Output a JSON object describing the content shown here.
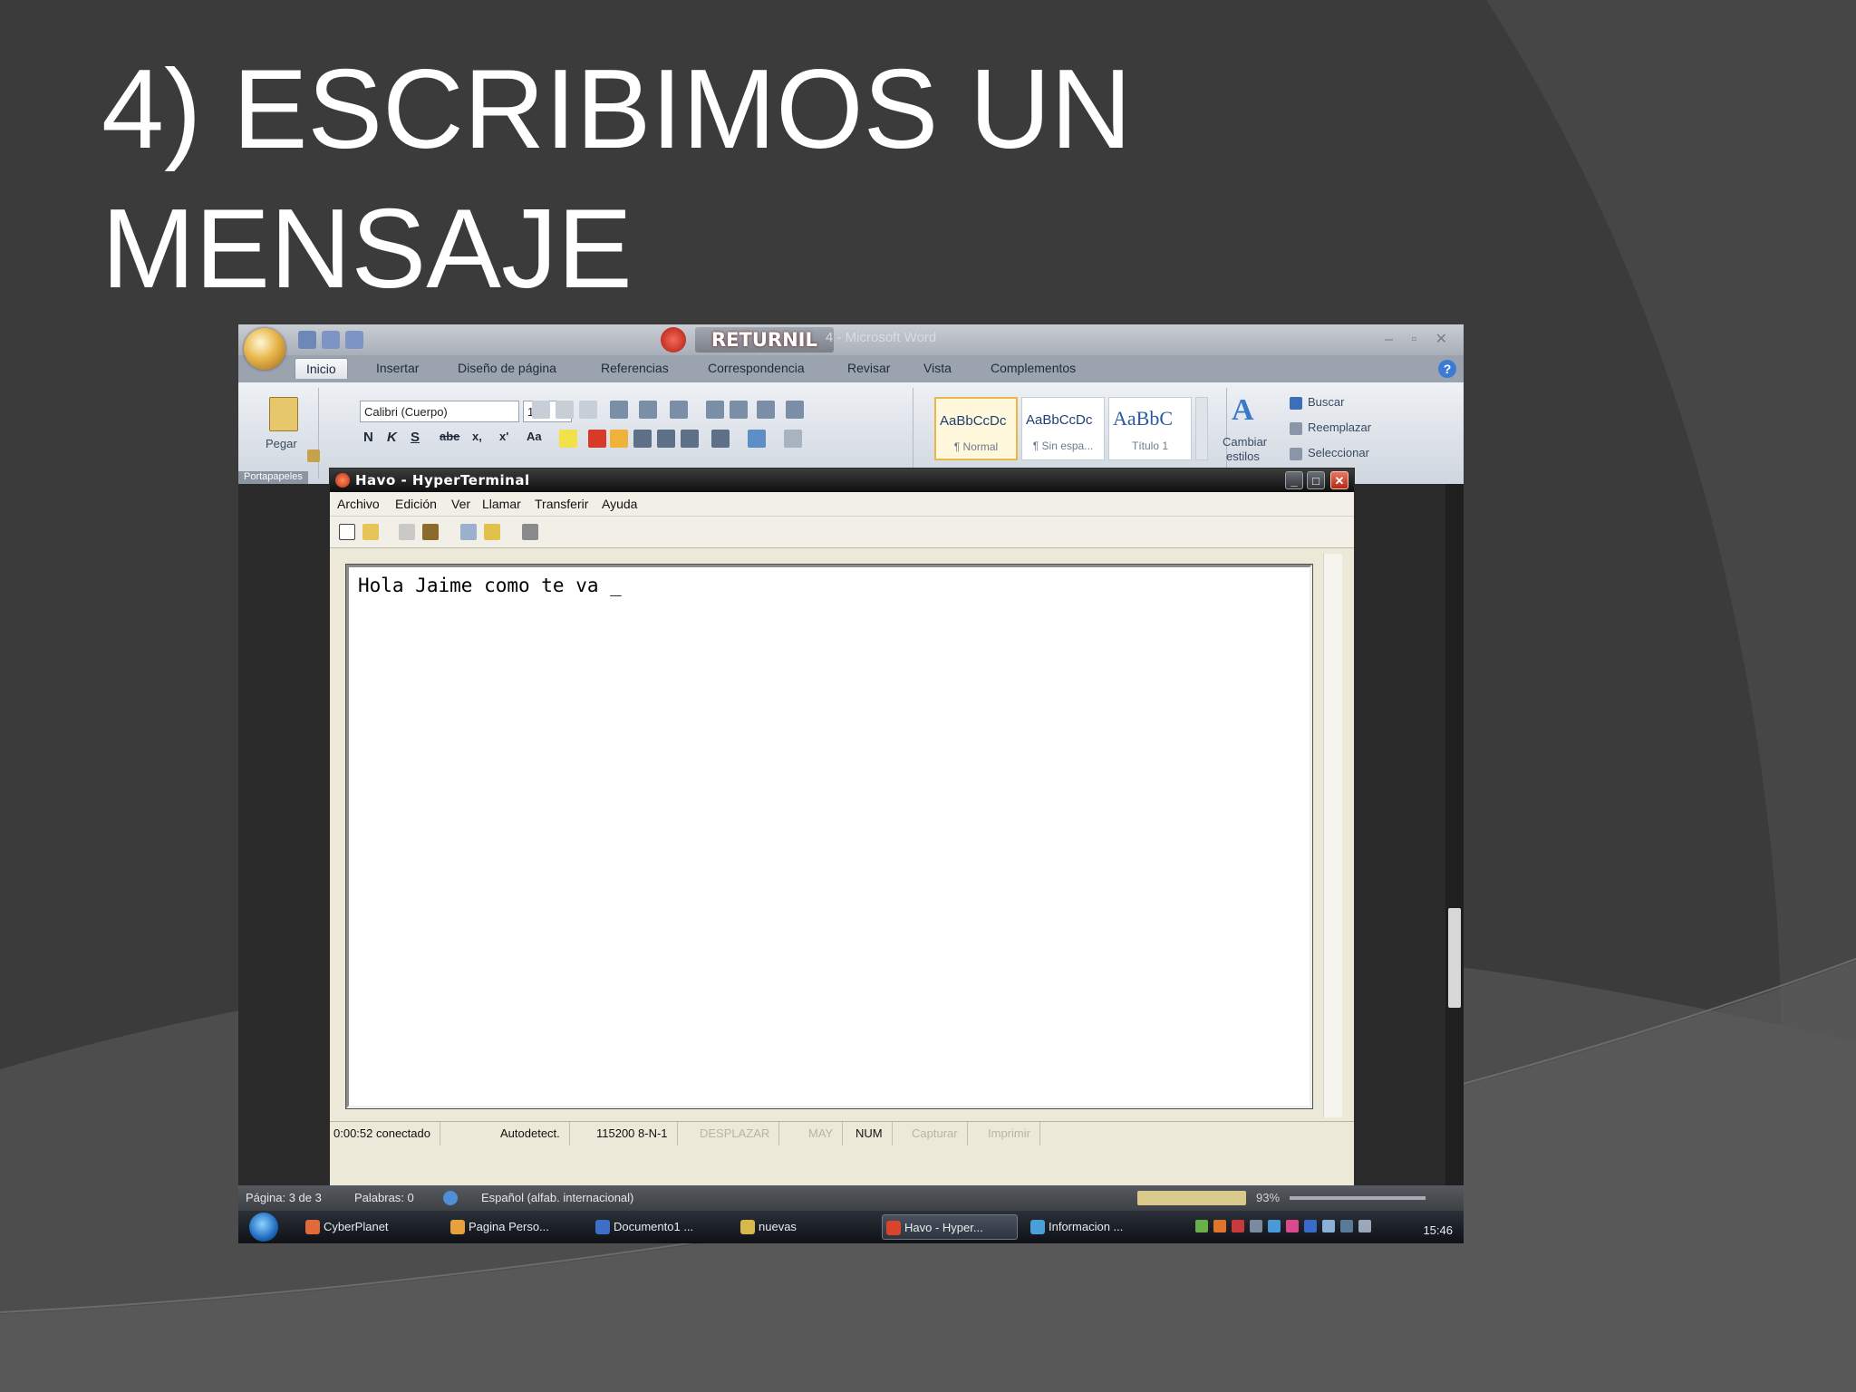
{
  "slide": {
    "title_line1": "4) ESCRIBIMOS UN",
    "title_line2": "MENSAJE"
  },
  "word": {
    "returnil_label": "RETURNIL",
    "title_suffix": "4 - Microsoft Word",
    "window_controls": "– ▫ ✕",
    "tabs": [
      "Inicio",
      "Insertar",
      "Diseño de página",
      "Referencias",
      "Correspondencia",
      "Revisar",
      "Vista",
      "Complementos"
    ],
    "help": "?",
    "paste_label": "Pegar",
    "clipboard_group": "Portapapeles",
    "font_name": "Calibri (Cuerpo)",
    "font_size": "11",
    "format_buttons": [
      "N",
      "K",
      "S",
      "abe",
      "x,",
      "x'",
      "Aa"
    ],
    "styles": [
      {
        "preview": "AaBbCcDc",
        "name": "¶ Normal"
      },
      {
        "preview": "AaBbCcDc",
        "name": "¶ Sin espa..."
      },
      {
        "preview": "AaBbC",
        "name": "Título 1"
      }
    ],
    "change_styles_1": "Cambiar",
    "change_styles_2": "estilos",
    "edit_buttons": [
      "Buscar",
      "Reemplazar",
      "Seleccionar"
    ],
    "status": {
      "page": "Página: 3 de 3",
      "words": "Palabras: 0",
      "language": "Español (alfab. internacional)",
      "zoom": "93%"
    }
  },
  "hyperterminal": {
    "title": "Havo - HyperTerminal",
    "menu": [
      "Archivo",
      "Edición",
      "Ver",
      "Llamar",
      "Transferir",
      "Ayuda"
    ],
    "terminal_text": "Hola Jaime como te va _",
    "status": {
      "connected": "0:00:52 conectado",
      "detect": "Autodetect.",
      "settings": "115200 8-N-1",
      "scroll": "DESPLAZAR",
      "caps": "MAY",
      "num": "NUM",
      "capture": "Capturar",
      "print": "Imprimir"
    }
  },
  "taskbar": {
    "items": [
      "CyberPlanet",
      "Pagina Perso...",
      "Documento1 ...",
      "nuevas",
      "Havo - Hyper...",
      "Informacion ..."
    ],
    "clock": "15:46"
  }
}
